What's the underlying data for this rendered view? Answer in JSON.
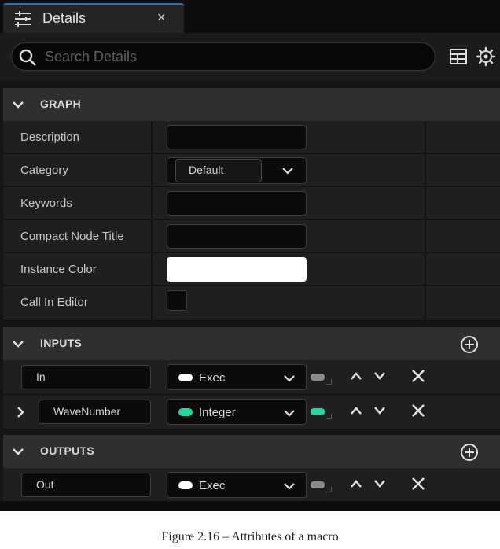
{
  "tab": {
    "title": "Details",
    "close": "×"
  },
  "search": {
    "placeholder": "Search Details",
    "value": ""
  },
  "sections": {
    "graph": {
      "title": "GRAPH"
    },
    "inputs": {
      "title": "INPUTS"
    },
    "outputs": {
      "title": "OUTPUTS"
    }
  },
  "graph": {
    "description_label": "Description",
    "category_label": "Category",
    "category_value": "Default",
    "keywords_label": "Keywords",
    "compact_label": "Compact Node Title",
    "color_label": "Instance Color",
    "call_label": "Call In Editor"
  },
  "inputs": [
    {
      "name": "In",
      "type": "Exec"
    },
    {
      "name": "WaveNumber",
      "type": "Integer"
    }
  ],
  "outputs": [
    {
      "name": "Out",
      "type": "Exec"
    }
  ],
  "colors": {
    "exec_pin": "#ffffff",
    "integer_pin": "#1fd9a0",
    "instance_color": "#ffffff",
    "tab_accent": "#2b6fb4"
  },
  "caption": "Figure 2.16 – Attributes of a macro"
}
